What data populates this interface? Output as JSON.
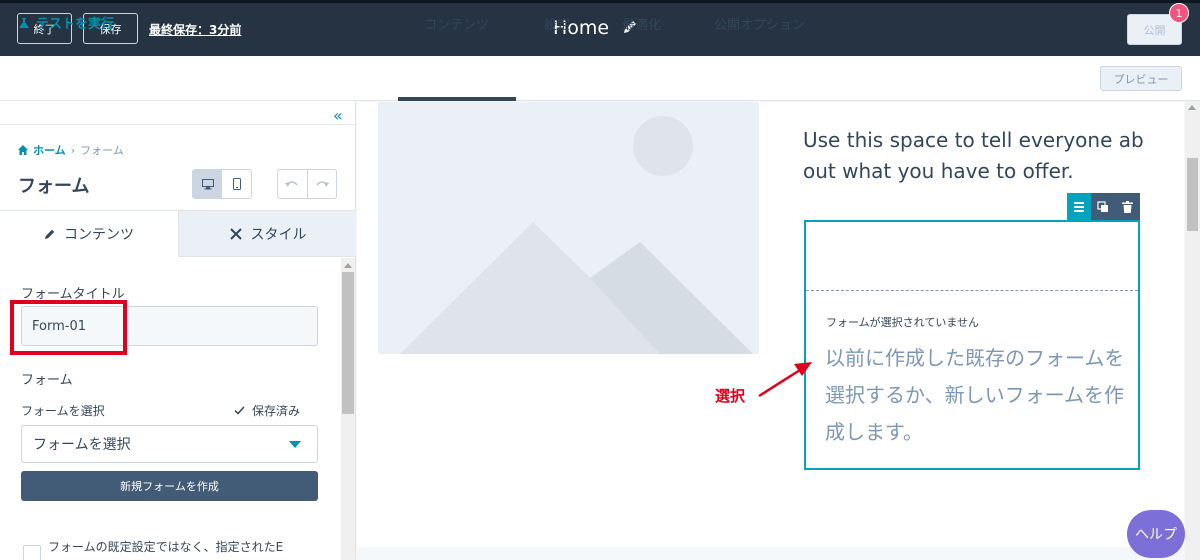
{
  "topbar": {
    "exit_label": "終了",
    "save_label": "保存",
    "last_saved": "最終保存：3分前",
    "page_title": "Home",
    "publish_label": "公開",
    "notification_count": "1"
  },
  "subbar": {
    "test_link": "テストを実行",
    "tabs": [
      {
        "label": "コンテンツ",
        "active": true
      },
      {
        "label": "設定",
        "active": false
      },
      {
        "label": "最適化",
        "active": false
      },
      {
        "label": "公開オプション",
        "active": false
      }
    ],
    "preview_label": "プレビュー"
  },
  "left_panel": {
    "breadcrumb": {
      "home": "ホーム",
      "separator": "›",
      "current": "フォーム"
    },
    "title": "フォーム",
    "tabs": {
      "content": "コンテンツ",
      "style": "スタイル"
    },
    "form_title_label": "フォームタイトル",
    "form_title_value": "Form-01",
    "form_section_label": "フォーム",
    "select_form_label": "フォームを選択",
    "saved_status": "保存済み",
    "select_value": "フォームを選択",
    "new_form_button": "新規フォームを作成",
    "checkbox_label": "フォームの既定設定ではなく、指定されたE"
  },
  "preview": {
    "hero_text": "Use this space to tell everyone about what you have to offer.",
    "form_note": "フォームが選択されていません",
    "form_message": "以前に作成した既存のフォームを選択するか、新しいフォームを作成します。",
    "annotation": "選択"
  },
  "help_label": "ヘルプ",
  "colors": {
    "topbar": "#253342",
    "accent": "#00a4bd",
    "link": "#0091ae",
    "annotation_red": "#e0001b",
    "help_purple": "#7c6fd8"
  }
}
